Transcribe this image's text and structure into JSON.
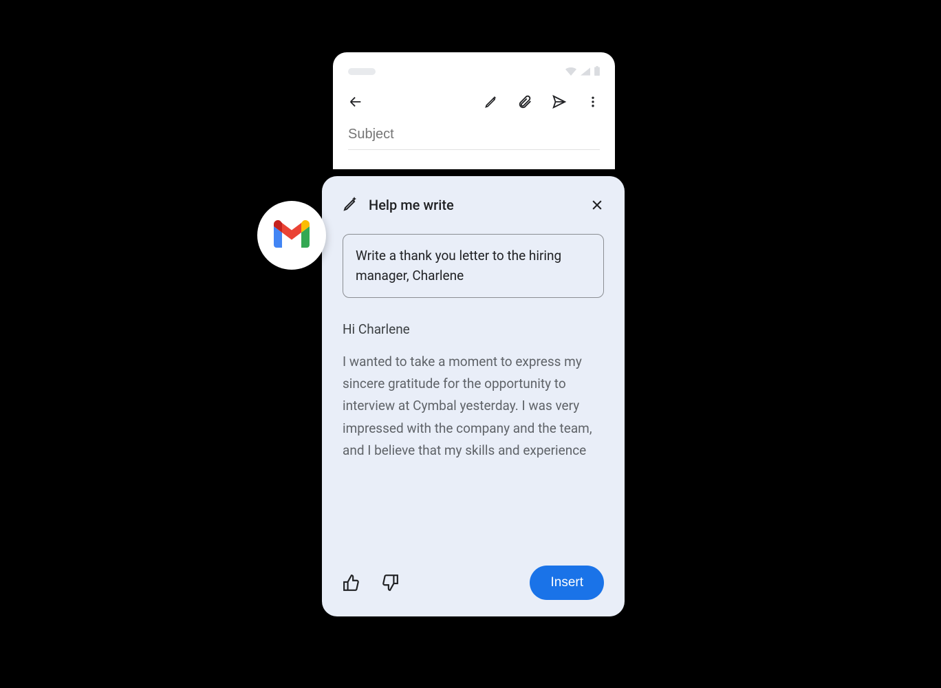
{
  "compose": {
    "subject_placeholder": "Subject",
    "subject_value": ""
  },
  "panel": {
    "title": "Help me write",
    "prompt": "Write a thank you letter to the hiring manager, Charlene",
    "greeting": "Hi Charlene",
    "body": "I wanted to take a moment to express my sincere gratitude for the opportunity to interview at Cymbal yesterday. I was very impressed with the company and the team, and I believe that my skills and experience",
    "insert_label": "Insert"
  },
  "icons": {
    "back": "back-arrow-icon",
    "pencil_sparkle": "pencil-sparkle-icon",
    "attachment": "attachment-icon",
    "send": "send-icon",
    "more": "more-vert-icon",
    "close": "close-icon",
    "thumbs_up": "thumbs-up-icon",
    "thumbs_down": "thumbs-down-icon",
    "gmail": "gmail-icon",
    "wifi": "wifi-icon",
    "signal": "signal-icon",
    "battery": "battery-icon"
  },
  "colors": {
    "background": "#000000",
    "panel_bg": "#e9eef8",
    "primary_blue": "#1a73e8",
    "text_primary": "#202124",
    "text_secondary": "#5f6368"
  }
}
